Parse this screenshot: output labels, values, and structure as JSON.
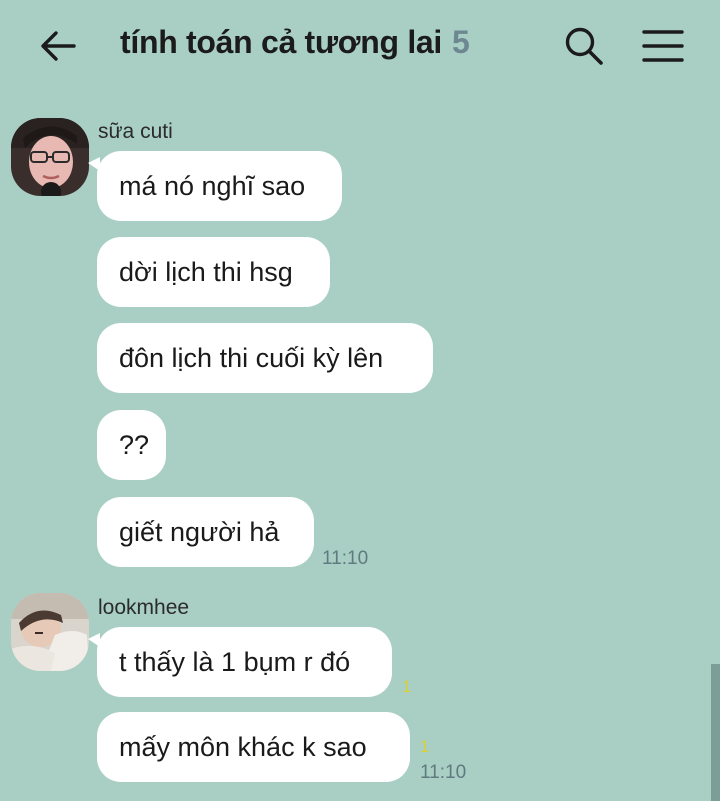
{
  "header": {
    "title": "tính toán cả tương lai",
    "member_count": "5"
  },
  "messages": [
    {
      "sender": "sữa cuti",
      "bubbles": [
        "má nó nghĩ sao",
        "dời lịch thi hsg",
        "đôn lịch thi cuối kỳ lên",
        "??",
        "giết người hả"
      ],
      "time": "11:10"
    },
    {
      "sender": "lookmhee",
      "bubbles": [
        "t thấy là 1 bụm r đó",
        "mấy môn khác k sao"
      ],
      "unread_1": "1",
      "unread_2": "1",
      "time": "11:10"
    }
  ],
  "colors": {
    "background": "#a9cfc4",
    "bubble": "#ffffff",
    "unread": "#d7cf3a"
  },
  "icons": [
    "back-arrow-icon",
    "search-icon",
    "menu-icon"
  ]
}
